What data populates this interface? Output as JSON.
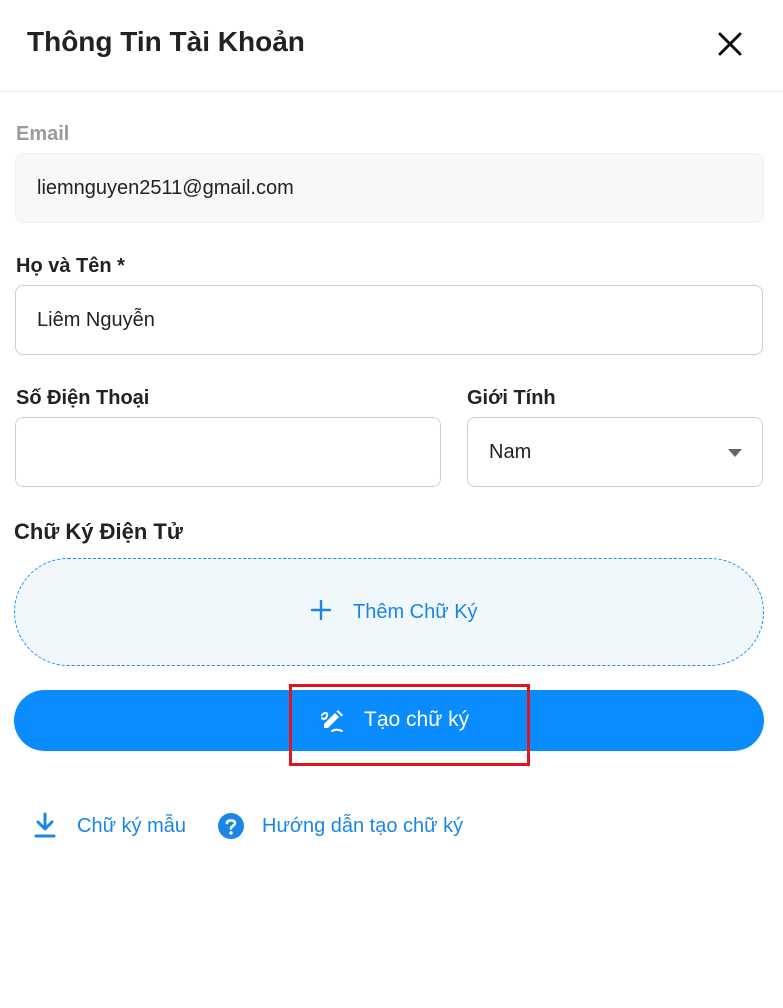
{
  "header": {
    "title": "Thông Tin Tài Khoản",
    "close_icon": "close-icon"
  },
  "email": {
    "label": "Email",
    "value": "liemnguyen2511@gmail.com"
  },
  "fullname": {
    "label": "Họ và Tên *",
    "value": "Liêm Nguyễn"
  },
  "phone": {
    "label": "Số Điện Thoại",
    "value": "",
    "placeholder": ""
  },
  "gender": {
    "label": "Giới Tính",
    "selected": "Nam"
  },
  "signature": {
    "label": "Chữ Ký Điện Tử",
    "add_label": "Thêm Chữ Ký",
    "create_label": "Tạo chữ ký"
  },
  "links": {
    "sample_label": "Chữ ký mẫu",
    "guide_label": "Hướng dẫn tạo chữ ký"
  },
  "colors": {
    "accent": "#0a8cff",
    "link": "#1a86e8",
    "highlight": "#e0151f",
    "signature_bg": "#f1f8fc"
  }
}
